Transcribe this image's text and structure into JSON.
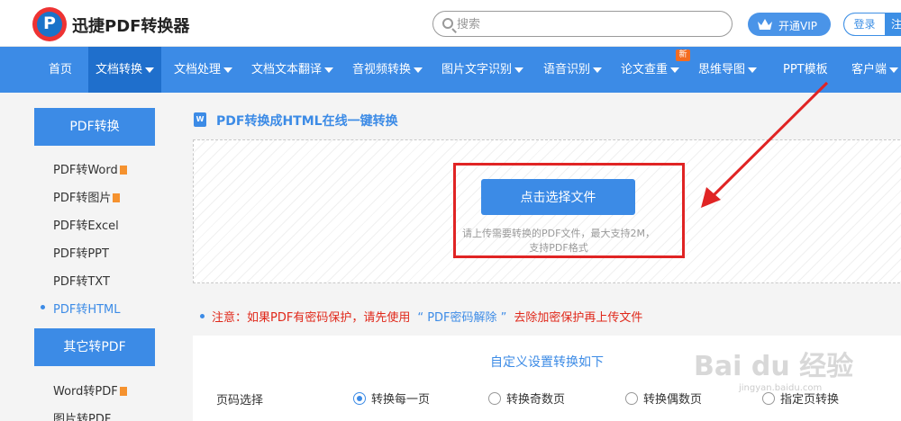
{
  "header": {
    "brand": "迅捷PDF转换器",
    "search_placeholder": "搜索",
    "vip_label": "开通VIP",
    "login_label": "登录",
    "register_label": "注"
  },
  "nav": {
    "items": [
      {
        "label": "首页"
      },
      {
        "label": "文档转换"
      },
      {
        "label": "文档处理"
      },
      {
        "label": "文档文本翻译"
      },
      {
        "label": "音视频转换"
      },
      {
        "label": "图片文字识别"
      },
      {
        "label": "语音识别"
      },
      {
        "label": "论文查重"
      },
      {
        "label": "思维导图"
      },
      {
        "label": "PPT模板"
      },
      {
        "label": "客户端"
      }
    ],
    "new_badge": "新"
  },
  "sidebar": {
    "section1": "PDF转换",
    "items": [
      {
        "label": "PDF转Word"
      },
      {
        "label": "PDF转图片"
      },
      {
        "label": "PDF转Excel"
      },
      {
        "label": "PDF转PPT"
      },
      {
        "label": "PDF转TXT"
      },
      {
        "label": "PDF转HTML"
      }
    ],
    "section2": "其它转PDF",
    "items2": [
      {
        "label": "Word转PDF"
      },
      {
        "label": "图片转PDF"
      }
    ]
  },
  "main": {
    "title_icon": "W",
    "title": "PDF转换成HTML在线一键转换",
    "upload_button": "点击选择文件",
    "hint_line1": "请上传需要转换的PDF文件，最大支持2M，",
    "hint_line2": "支持PDF格式",
    "notice_prefix": "注意：如果PDF有密码保护，请先使用",
    "notice_link": "“ PDF密码解除 ”",
    "notice_suffix": "去除加密保护再上传文件",
    "settings_title": "自定义设置转换如下",
    "page_select_label": "页码选择",
    "options": [
      {
        "label": "转换每一页",
        "checked": true
      },
      {
        "label": "转换奇数页",
        "checked": false
      },
      {
        "label": "转换偶数页",
        "checked": false
      },
      {
        "label": "指定页转换",
        "checked": false
      }
    ]
  },
  "watermark": {
    "text": "Bai du 经验",
    "url": "jingyan.baidu.com"
  },
  "colors": {
    "primary": "#3c8be6",
    "nav_active": "#1f6fcc",
    "warning": "#e0281a",
    "annotation": "#e02424"
  }
}
